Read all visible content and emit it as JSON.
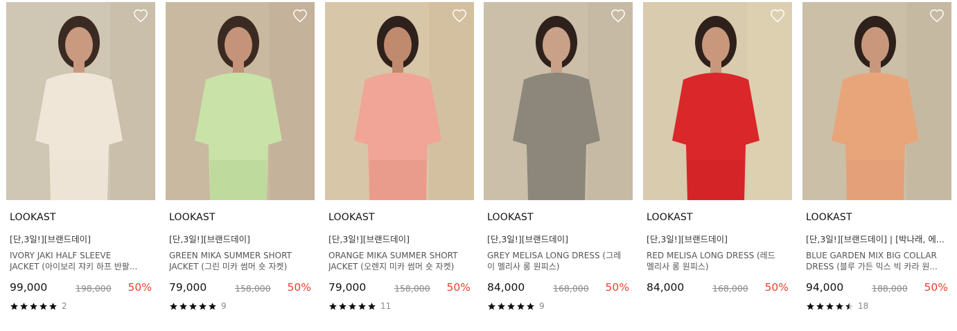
{
  "products": [
    {
      "brand": "LOOKAST",
      "tag": "[단,3일!][브랜드데이]",
      "title_line1": "IVORY JAKI HALF SLEEVE",
      "title_line2": "JACKET (아이보리 쟈키 하프 반팔...",
      "price": "99,000",
      "original_price": "198,000",
      "discount": "50%",
      "rating_count": "2",
      "rating": 5,
      "image": {
        "bg": "#cfc6b3",
        "wall": "#bdb29c",
        "garment": "#efe6d8",
        "bottom": "#ece3d5",
        "skin": "#c99a7f",
        "hair": "#3a2a22"
      }
    },
    {
      "brand": "LOOKAST",
      "tag": "[단,3일!][브랜드데이]",
      "title_line1": "GREEN MIKA SUMMER SHORT",
      "title_line2": "JACKET (그린 미카 썸머 숏 자켓)",
      "price": "79,000",
      "original_price": "158,000",
      "discount": "50%",
      "rating_count": "9",
      "rating": 5,
      "image": {
        "bg": "#c9b9a0",
        "wall": "#b9a98f",
        "garment": "#c8e2a8",
        "bottom": "#bcd99a",
        "skin": "#c4937a",
        "hair": "#3a2a22"
      }
    },
    {
      "brand": "LOOKAST",
      "tag": "[단,3일!][브랜드데이]",
      "title_line1": "ORANGE MIKA SUMMER SHORT",
      "title_line2": "JACKET (오렌지 미카 썸머 숏 자켓)",
      "price": "79,000",
      "original_price": "158,000",
      "discount": "50%",
      "rating_count": "11",
      "rating": 5,
      "image": {
        "bg": "#d8c6a8",
        "wall": "#c9b593",
        "garment": "#f0a596",
        "bottom": "#e99b8b",
        "skin": "#c08a6f",
        "hair": "#2e211b"
      }
    },
    {
      "brand": "LOOKAST",
      "tag": "[단,3일!][브랜드데이]",
      "title_line1": "GREY MELISA LONG DRESS (그레",
      "title_line2": "이 멜리사 롱 원피스)",
      "price": "84,000",
      "original_price": "168,000",
      "discount": "50%",
      "rating_count": "9",
      "rating": 5,
      "image": {
        "bg": "#cbbfa9",
        "wall": "#bfb39b",
        "garment": "#8c877a",
        "bottom": "#8c877a",
        "skin": "#c9a088",
        "hair": "#2e211b"
      }
    },
    {
      "brand": "LOOKAST",
      "tag": "[단,3일!][브랜드데이]",
      "title_line1": "RED MELISA LONG DRESS (레드",
      "title_line2": "멜리사 롱 원피스)",
      "price": "84,000",
      "original_price": "168,000",
      "discount": "50%",
      "rating_count": "",
      "rating": 0,
      "image": {
        "bg": "#d9cbae",
        "wall": "#e6d9b5",
        "garment": "#d9272a",
        "bottom": "#d32528",
        "skin": "#c9987c",
        "hair": "#2e211b"
      }
    },
    {
      "brand": "LOOKAST",
      "tag": "[단,3일!][브랜드데이] | [박나래, 에...",
      "title_line1": "BLUE GARDEN MIX BIG COLLAR",
      "title_line2": "DRESS (블루 가든 믹스 빅 카라 원...",
      "price": "94,000",
      "original_price": "188,000",
      "discount": "50%",
      "rating_count": "18",
      "rating": 4.5,
      "image": {
        "bg": "#cbbfa8",
        "wall": "#bcb099",
        "garment": "#e8a57a",
        "bottom": "#e3a078",
        "skin": "#c9987c",
        "hair": "#2e211b"
      }
    }
  ],
  "colors": {
    "discount": "#e8412b",
    "star": "#111111",
    "heart": "#ffffff"
  },
  "icons": {
    "wishlist": "heart-outline-icon",
    "rating": "star-icon"
  }
}
